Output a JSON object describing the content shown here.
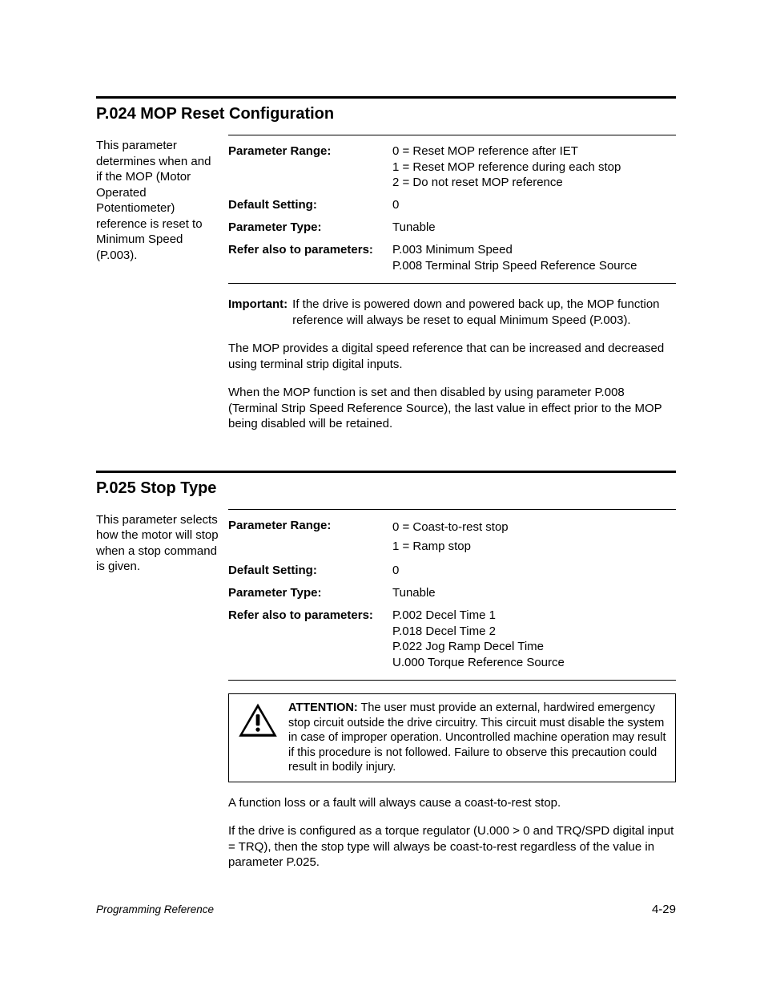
{
  "sections": [
    {
      "title": "P.024 MOP Reset Configuration",
      "side_note": "This parameter determines when and if the MOP (Motor Operated Potentiometer) reference is reset to Minimum Speed (P.003).",
      "params": [
        {
          "label": "Parameter Range:",
          "value": "0 = Reset MOP reference after IET\n1 = Reset MOP reference during each stop\n2 = Do not reset MOP reference"
        },
        {
          "label": "Default Setting:",
          "value": "0"
        },
        {
          "label": "Parameter Type:",
          "value": "Tunable"
        },
        {
          "label": "Refer also to parameters:",
          "value": "P.003 Minimum Speed\nP.008 Terminal Strip Speed Reference Source"
        }
      ],
      "important": {
        "label": "Important:",
        "text": "If the drive is powered down and powered back up, the MOP function reference will always be reset to equal Minimum Speed (P.003)."
      },
      "body": [
        "The MOP provides a digital speed reference that can be increased and decreased using terminal strip digital inputs.",
        "When the MOP function is set and then disabled by using parameter P.008 (Terminal Strip Speed Reference Source), the last value in effect prior to the MOP being disabled will be retained."
      ]
    },
    {
      "title": "P.025 Stop Type",
      "side_note": "This parameter selects how the motor will stop when a stop command is given.",
      "params": [
        {
          "label": "Parameter Range:",
          "value": "0 = Coast-to-rest stop\n1 = Ramp stop"
        },
        {
          "label": "Default Setting:",
          "value": "0"
        },
        {
          "label": "Parameter Type:",
          "value": "Tunable"
        },
        {
          "label": "Refer also to parameters:",
          "value": "P.002 Decel Time 1\nP.018 Decel Time 2\nP.022 Jog Ramp Decel Time\nU.000 Torque Reference Source"
        }
      ],
      "attention": {
        "label": "ATTENTION:",
        "text": "The user must provide an external, hardwired emergency stop circuit outside the drive circuitry. This circuit must disable the system in case of improper operation. Uncontrolled machine operation may result if this procedure is not followed. Failure to observe this precaution could result in bodily injury."
      },
      "body": [
        "A function loss or a fault will always cause a coast-to-rest stop.",
        "If the drive is configured as a torque regulator (U.000 > 0 and TRQ/SPD digital input = TRQ), then the stop type will always be coast-to-rest regardless of the value in parameter P.025."
      ]
    }
  ],
  "footer": {
    "left": "Programming Reference",
    "right": "4-29"
  }
}
